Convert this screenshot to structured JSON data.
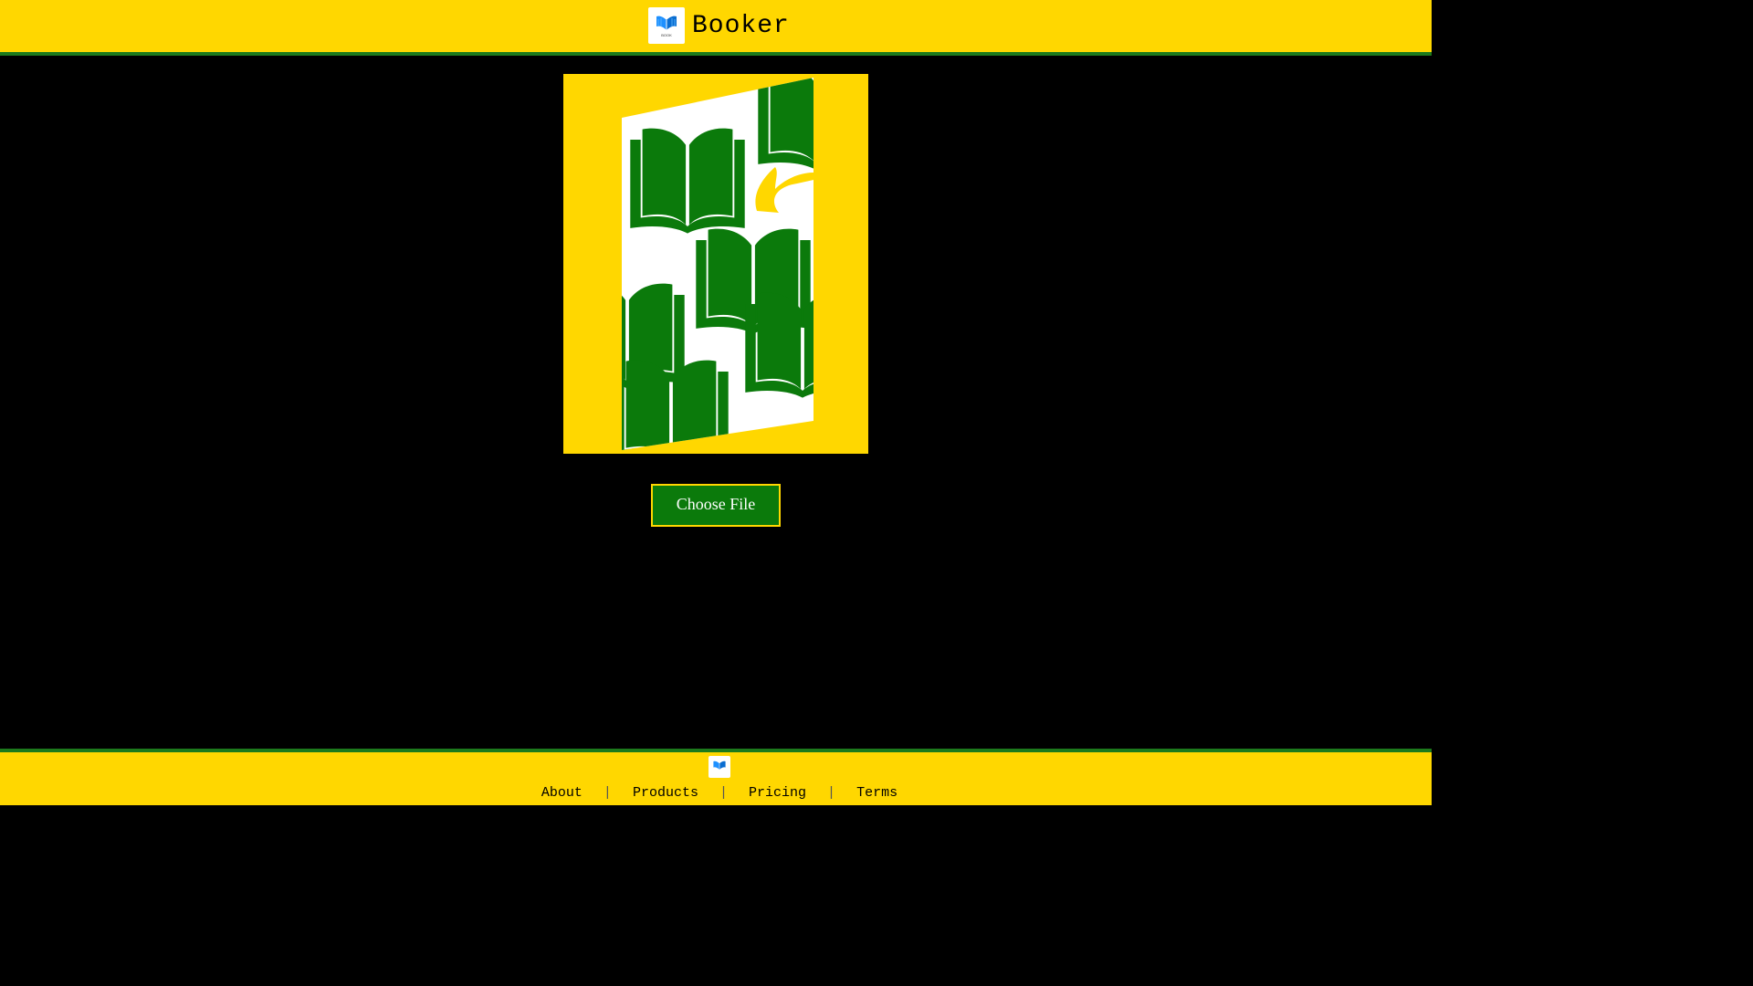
{
  "header": {
    "brand": "Booker",
    "logo_icon": "book-logo-icon",
    "logo_caption": "BOOK"
  },
  "main": {
    "cover_image_icon": "open-books-pattern-image",
    "choose_file_label": "Choose File"
  },
  "footer": {
    "logo_icon": "book-logo-icon",
    "links": [
      "About",
      "Products",
      "Pricing",
      "Terms"
    ],
    "separator": "|"
  },
  "colors": {
    "brand_yellow": "#FFD700",
    "brand_green": "#0B7A0B",
    "background": "#000000"
  }
}
